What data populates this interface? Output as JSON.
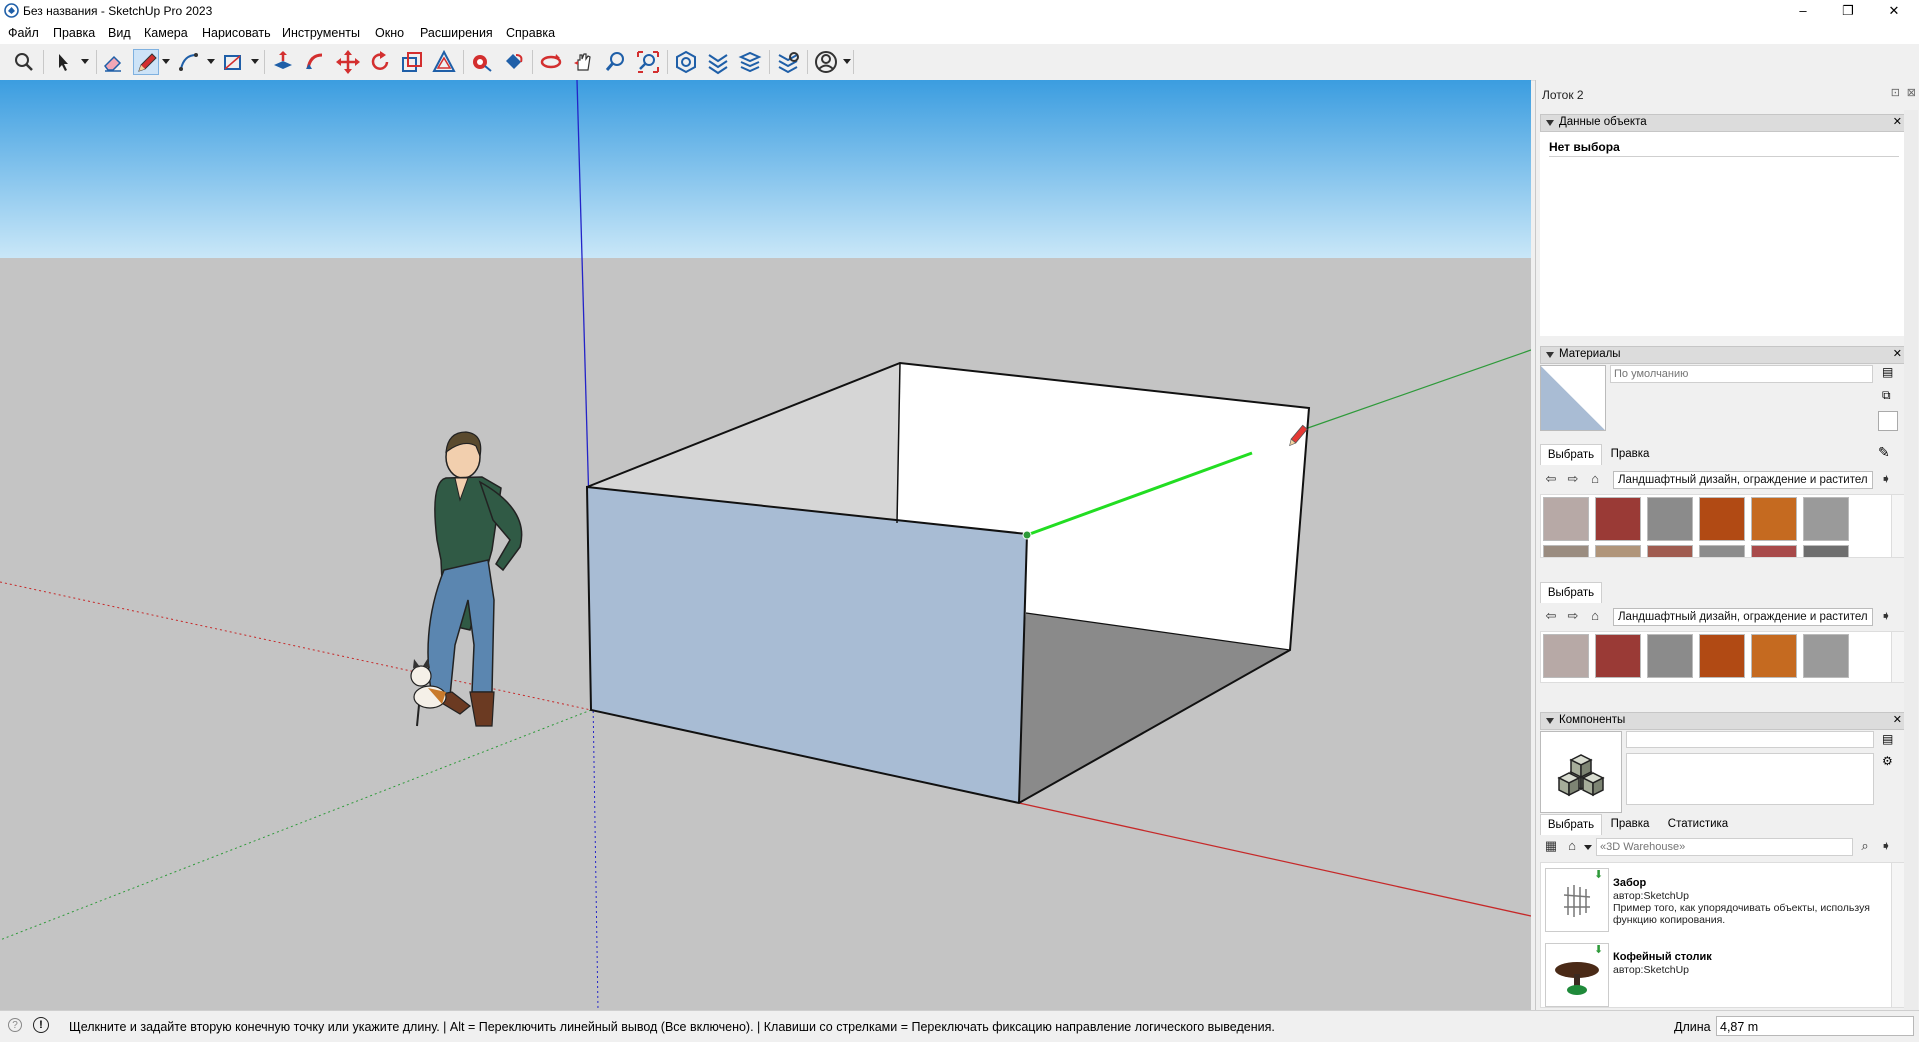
{
  "window": {
    "title": "Без названия - SketchUp Pro 2023",
    "minimize": "–",
    "restore": "❐",
    "close": "✕"
  },
  "menu": [
    "Файл",
    "Правка",
    "Вид",
    "Камера",
    "Нарисовать",
    "Инструменты",
    "Окно",
    "Расширения",
    "Справка"
  ],
  "tray": {
    "title": "Лоток 2",
    "entity_info": {
      "header": "Данные объекта",
      "selection": "Нет выбора"
    },
    "materials": {
      "header": "Материалы",
      "name_placeholder": "По умолчанию",
      "tabs": [
        "Выбрать",
        "Правка"
      ],
      "collection": "Ландшафтный дизайн, ограждение и растител",
      "second_tab": "Выбрать",
      "second_collection": "Ландшафтный дизайн, ограждение и растител",
      "swatches": [
        "#b7a9a6",
        "#9a3a36",
        "#8b8b8b",
        "#b14a14",
        "#c56a20",
        "#9a9a9a",
        "#9a8c80",
        "#b0957a",
        "#a05c50",
        "#8c8c8c",
        "#a84a4a",
        "#6e6e6e"
      ]
    },
    "components": {
      "header": "Компоненты",
      "tabs": [
        "Выбрать",
        "Правка",
        "Статистика"
      ],
      "search_placeholder": "«3D Warehouse»",
      "results": [
        {
          "title": "Забор",
          "author": "автор:SketchUp",
          "desc": "Пример того, как упорядочивать объекты, используя функцию копирования."
        },
        {
          "title": "Кофейный столик",
          "author": "автор:SketchUp",
          "desc": ""
        }
      ]
    }
  },
  "status": {
    "message": "Щелкните и задайте вторую конечную точку или укажите длину. | Alt = Переключить линейный вывод (Все включено). | Клавиши со стрелками = Переключать фиксацию направление логического выведения.",
    "length_label": "Длина",
    "length_value": "4,87 m"
  },
  "icons": [
    "search-icon",
    "select-icon",
    "eraser-icon",
    "pencil-icon",
    "arc-icon",
    "shape-icon",
    "push-pull-icon",
    "follow-me-icon",
    "move-icon",
    "rotate-icon",
    "scale-icon",
    "offset-icon",
    "tape-measure-icon",
    "paint-bucket-icon",
    "orbit-icon",
    "pan-icon",
    "zoom-icon",
    "zoom-extents-icon",
    "warehouse-icon",
    "extension-warehouse-icon",
    "layout-icon",
    "extension-manager-icon",
    "account-icon"
  ],
  "colors": {
    "sky_top": "#4aa3e2",
    "sky_bottom": "#c8e6f8",
    "ground": "#c2c2c2",
    "box_front": "#a9bcd4",
    "axis_red": "#c62828",
    "axis_green": "#2e9a3a",
    "axis_blue": "#2323c8",
    "draw_line": "#22dd22"
  }
}
